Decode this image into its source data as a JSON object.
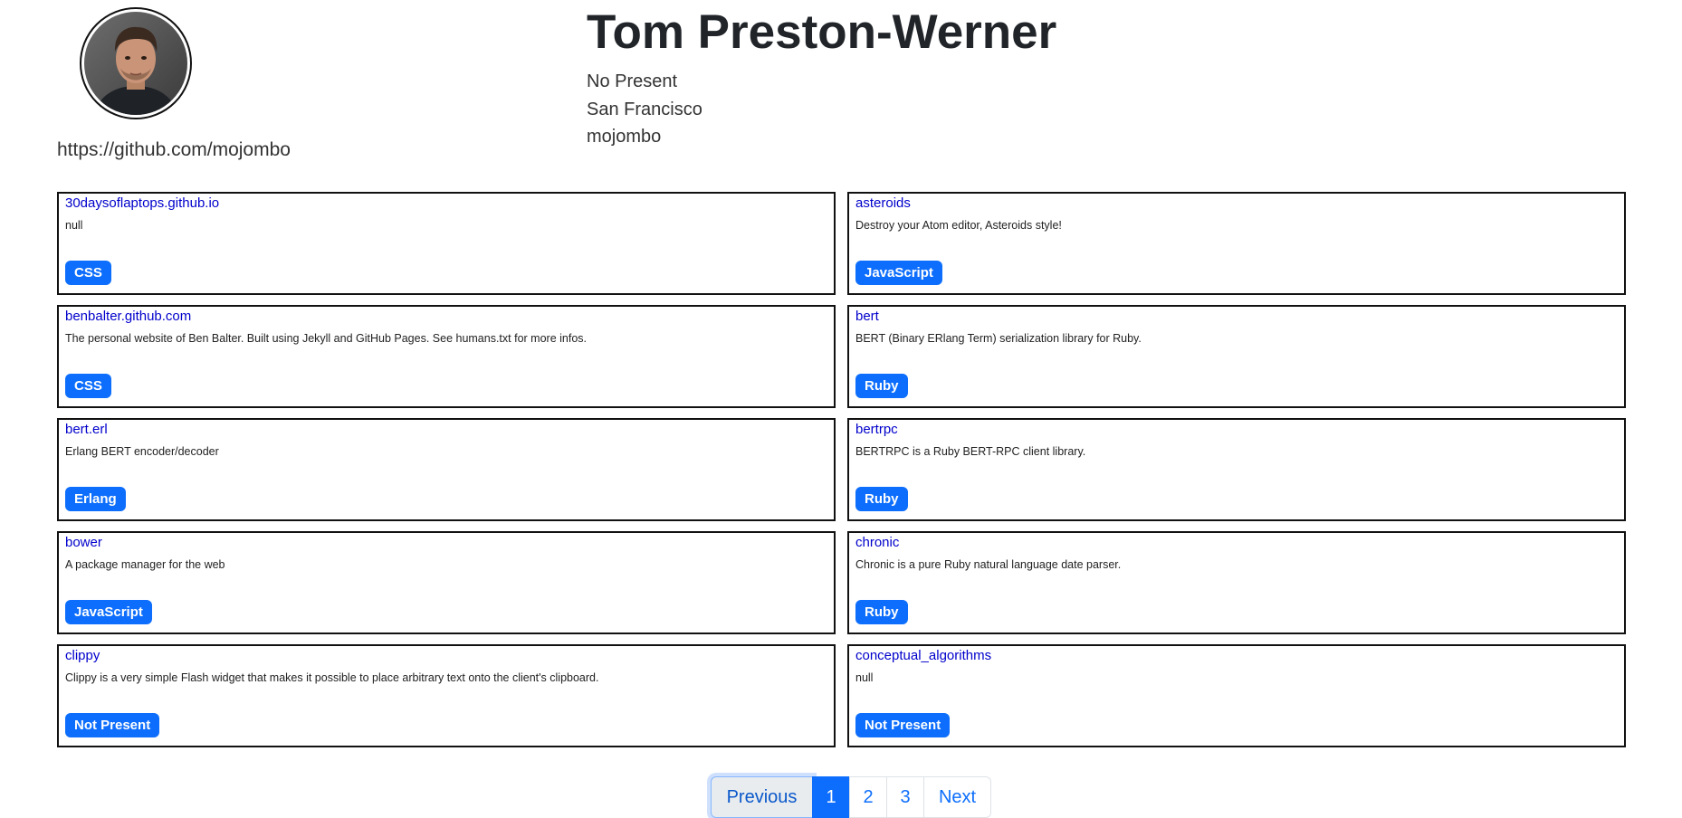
{
  "profile": {
    "name": "Tom Preston-Werner",
    "company": "No Present",
    "location": "San Francisco",
    "username": "mojombo",
    "url": "https://github.com/mojombo"
  },
  "repos": [
    {
      "name": "30daysoflaptops.github.io",
      "description": "null",
      "language": "CSS"
    },
    {
      "name": "asteroids",
      "description": "Destroy your Atom editor, Asteroids style!",
      "language": "JavaScript"
    },
    {
      "name": "benbalter.github.com",
      "description": "The personal website of Ben Balter. Built using Jekyll and GitHub Pages. See humans.txt for more infos.",
      "language": "CSS"
    },
    {
      "name": "bert",
      "description": "BERT (Binary ERlang Term) serialization library for Ruby.",
      "language": "Ruby"
    },
    {
      "name": "bert.erl",
      "description": "Erlang BERT encoder/decoder",
      "language": "Erlang"
    },
    {
      "name": "bertrpc",
      "description": "BERTRPC is a Ruby BERT-RPC client library.",
      "language": "Ruby"
    },
    {
      "name": "bower",
      "description": "A package manager for the web",
      "language": "JavaScript"
    },
    {
      "name": "chronic",
      "description": "Chronic is a pure Ruby natural language date parser.",
      "language": "Ruby"
    },
    {
      "name": "clippy",
      "description": "Clippy is a very simple Flash widget that makes it possible to place arbitrary text onto the client's clipboard.",
      "language": "Not Present"
    },
    {
      "name": "conceptual_algorithms",
      "description": "null",
      "language": "Not Present"
    }
  ],
  "pagination": {
    "previous": "Previous",
    "pages": [
      "1",
      "2",
      "3"
    ],
    "next": "Next",
    "current": "1"
  },
  "colors": {
    "accent": "#0d6efd",
    "link": "#0000cc"
  }
}
